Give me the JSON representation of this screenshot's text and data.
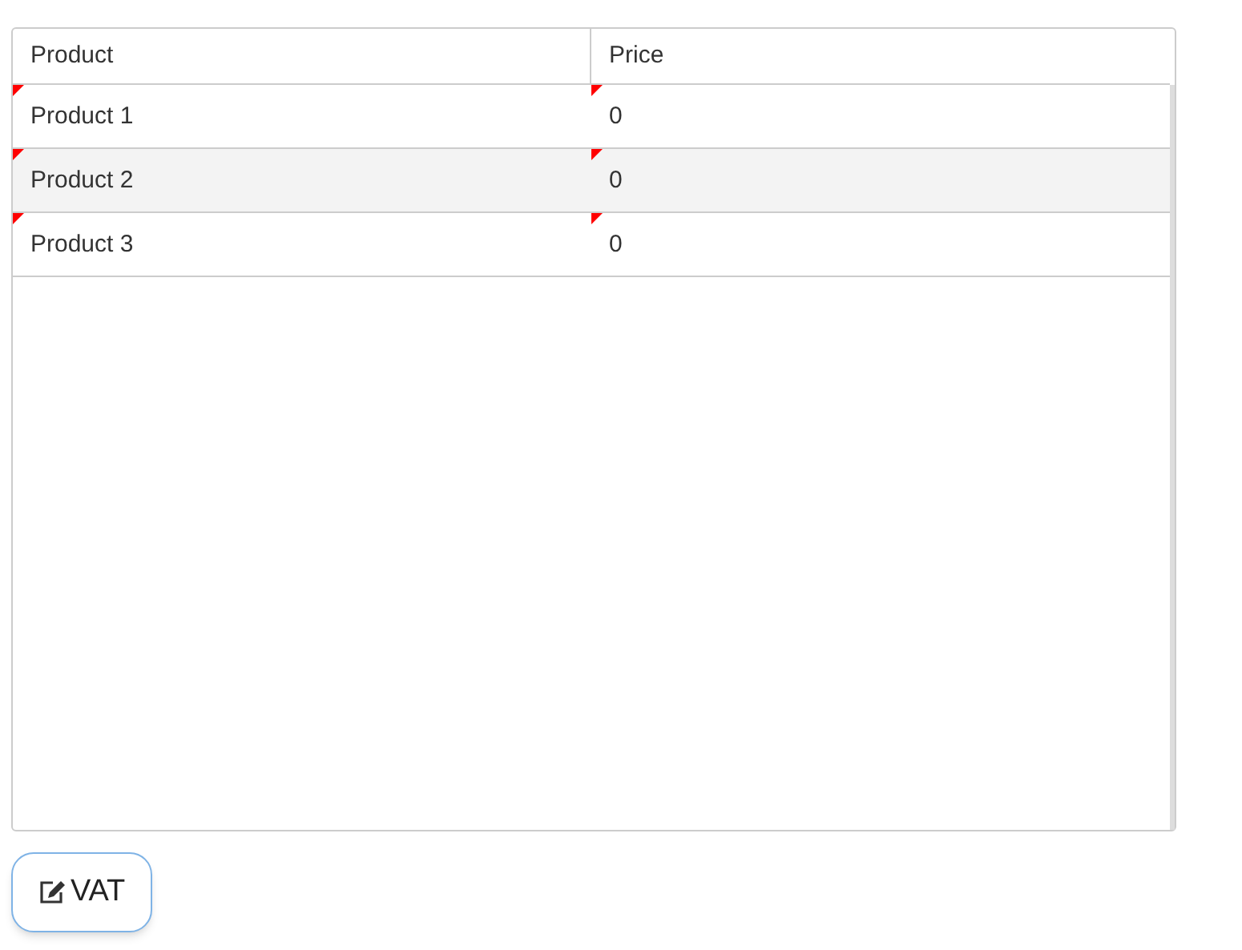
{
  "table": {
    "columns": [
      "Product",
      "Price"
    ],
    "rows": [
      {
        "cells": [
          {
            "text": "Product 1",
            "dirty": true
          },
          {
            "text": "0",
            "dirty": true
          }
        ]
      },
      {
        "cells": [
          {
            "text": "Product 2",
            "dirty": true
          },
          {
            "text": "0",
            "dirty": true
          }
        ]
      },
      {
        "cells": [
          {
            "text": "Product 3",
            "dirty": true
          },
          {
            "text": "0",
            "dirty": true
          }
        ]
      }
    ]
  },
  "button": {
    "label": "VAT"
  }
}
